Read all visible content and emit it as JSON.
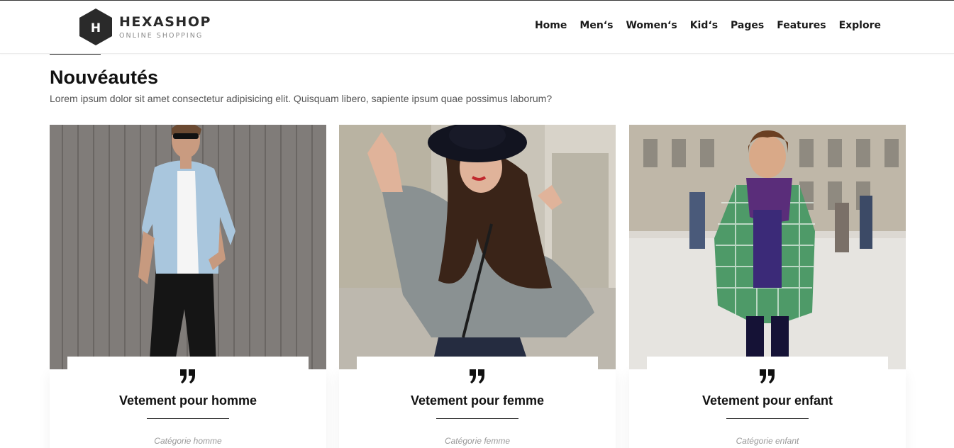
{
  "header": {
    "brand": "HEXASHOP",
    "brand_letter": "H",
    "tagline": "ONLINE SHOPPING",
    "nav": [
      "Home",
      "Men‘s",
      "Women‘s",
      "Kid‘s",
      "Pages",
      "Features",
      "Explore"
    ]
  },
  "section": {
    "title": "Nouvéautés",
    "subtitle": "Lorem ipsum dolor sit amet consectetur adipisicing elit. Quisquam libero, sapiente ipsum quae possimus laborum?"
  },
  "cards": [
    {
      "title": "Vetement pour homme",
      "category": "Catégorie homme"
    },
    {
      "title": "Vetement pour femme",
      "category": "Catégorie femme"
    },
    {
      "title": "Vetement pour enfant",
      "category": "Catégorie enfant"
    }
  ],
  "colors": {
    "text_dark": "#111111",
    "logo_hex": "#2a2a2a",
    "muted": "#999999"
  }
}
